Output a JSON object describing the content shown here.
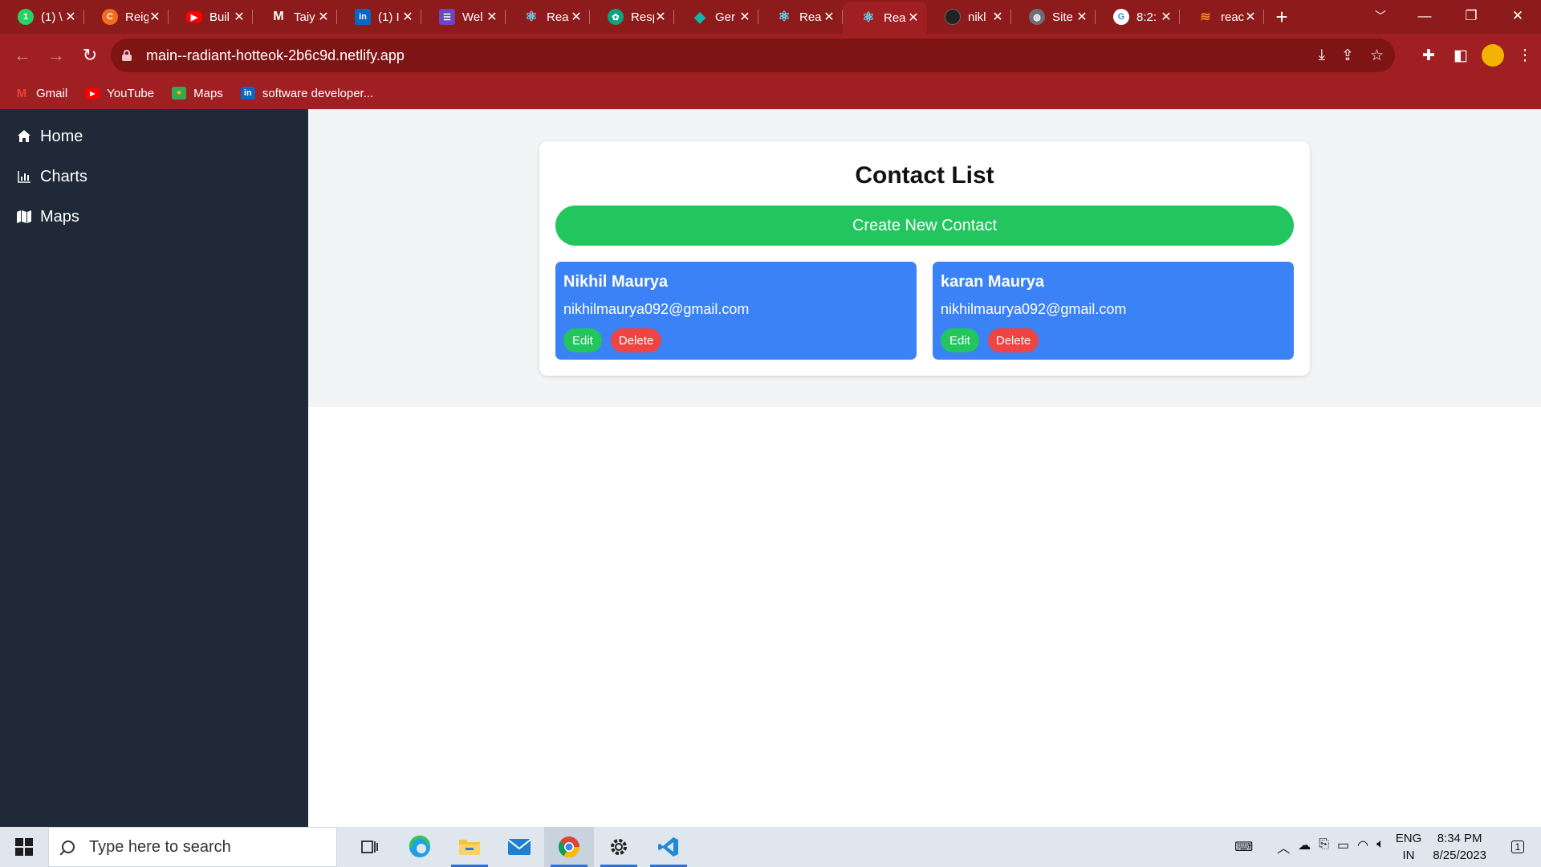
{
  "browser": {
    "tabs": [
      {
        "title": "(1) \\",
        "icon": "whatsapp-icon",
        "color": "#25d366"
      },
      {
        "title": "Reig",
        "icon": "codepen-swirl-icon",
        "color": "#f26d21"
      },
      {
        "title": "Buil",
        "icon": "youtube-icon",
        "color": "#ff0000"
      },
      {
        "title": "Taiy",
        "icon": "gmail-icon",
        "color": "#ffffff"
      },
      {
        "title": "(1) I",
        "icon": "linkedin-icon",
        "color": "#0a66c2"
      },
      {
        "title": "Wel",
        "icon": "list-app-icon",
        "color": "#6b46c1"
      },
      {
        "title": "Rea",
        "icon": "react-icon",
        "color": "#61dafb"
      },
      {
        "title": "Resp",
        "icon": "openai-icon",
        "color": "#10a37f"
      },
      {
        "title": "Ger",
        "icon": "diamond-icon",
        "color": "#0fb5ae"
      },
      {
        "title": "Rea",
        "icon": "react-icon",
        "color": "#61dafb"
      },
      {
        "title": "Rea",
        "icon": "react-icon",
        "color": "#61dafb",
        "active": true
      },
      {
        "title": "nikl",
        "icon": "github-icon",
        "color": "#ffffff"
      },
      {
        "title": "Site",
        "icon": "globe-icon",
        "color": "#9aa0a6"
      },
      {
        "title": "8:2:",
        "icon": "google-icon",
        "color": "#4285f4"
      },
      {
        "title": "reac",
        "icon": "stackoverflow-icon",
        "color": "#f48024"
      }
    ],
    "url": "main--radiant-hotteok-2b6c9d.netlify.app",
    "bookmarks": [
      {
        "label": "Gmail",
        "icon": "gmail-icon"
      },
      {
        "label": "YouTube",
        "icon": "youtube-icon"
      },
      {
        "label": "Maps",
        "icon": "maps-icon"
      },
      {
        "label": "software developer...",
        "icon": "linkedin-icon"
      }
    ]
  },
  "sidebar": {
    "items": [
      {
        "label": "Home",
        "icon": "home-icon"
      },
      {
        "label": "Charts",
        "icon": "bar-chart-icon"
      },
      {
        "label": "Maps",
        "icon": "map-icon"
      }
    ]
  },
  "main": {
    "title": "Contact List",
    "create_label": "Create New Contact",
    "contacts": [
      {
        "name": "Nikhil Maurya",
        "email": "nikhilmaurya092@gmail.com",
        "edit_label": "Edit",
        "delete_label": "Delete"
      },
      {
        "name": "karan Maurya",
        "email": "nikhilmaurya092@gmail.com",
        "edit_label": "Edit",
        "delete_label": "Delete"
      }
    ]
  },
  "taskbar": {
    "search_placeholder": "Type here to search",
    "lang_top": "ENG",
    "lang_bottom": "IN",
    "time": "8:34 PM",
    "date": "8/25/2023",
    "notification_count": "1"
  },
  "colors": {
    "browser_frame": "#8e1b1b",
    "sidebar": "#1f2937",
    "create_button": "#22c55e",
    "contact_card": "#3b82f6",
    "delete_button": "#ef4444"
  }
}
